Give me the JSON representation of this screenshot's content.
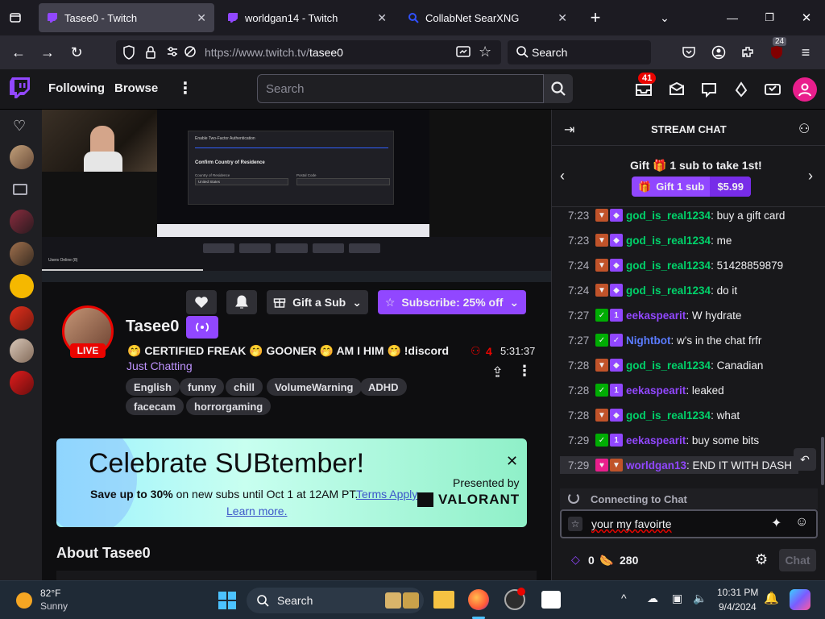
{
  "browser": {
    "tabs": [
      {
        "title": "Tasee0 - Twitch",
        "active": true
      },
      {
        "title": "worldgan14 - Twitch",
        "active": false
      },
      {
        "title": "CollabNet SearXNG",
        "active": false
      }
    ],
    "url_prefix": "https://www.twitch.tv/",
    "url_path": "tasee0",
    "search_placeholder": "Search",
    "extensions_badge": "24"
  },
  "twitch_nav": {
    "following": "Following",
    "browse": "Browse",
    "search_placeholder": "Search",
    "notifications_count": "41"
  },
  "stream": {
    "channel_name": "Tasee0",
    "live_label": "LIVE",
    "title": "🤭 CERTIFIED FREAK 🤭 GOONER 🤭 AM I HIM 🤭 !discord",
    "category": "Just Chatting",
    "viewers": "4",
    "uptime": "5:31:37",
    "tags": [
      "English",
      "funny",
      "chill",
      "VolumeWarning",
      "ADHD",
      "facecam",
      "horrorgaming"
    ],
    "gift_sub_label": "Gift a Sub",
    "subscribe_label": "Subscribe: 25% off"
  },
  "promo": {
    "headline": "Celebrate SUBtember!",
    "body_bold": "Save up to 30%",
    "body_rest": " on new subs until Oct 1 at 12AM PT.",
    "link1": "Terms Apply.",
    "link2": "Learn more.",
    "presented_by": "Presented by",
    "brand": "VALORANT"
  },
  "about_heading": "About Tasee0",
  "video_overlay": {
    "dialog_title": "Enable Two-Factor Authentication",
    "confirm_heading": "Confirm Country of Residence",
    "country_label": "Country of Residence",
    "country_value": "United States",
    "postal_label": "Postal Code",
    "taskbar_users": "Users Online (8)"
  },
  "chat": {
    "header": "STREAM CHAT",
    "gift_banner": "Gift 🎁 1 sub to take 1st!",
    "gift_button": "Gift 1 sub",
    "gift_price": "$5.99",
    "messages": [
      {
        "time": "7:23",
        "user": "god_is_real1234",
        "text": ": buy a gift card",
        "color": "green"
      },
      {
        "time": "7:23",
        "user": "god_is_real1234",
        "text": ": me",
        "color": "green"
      },
      {
        "time": "7:24",
        "user": "god_is_real1234",
        "text": ": 51428859879",
        "color": "green"
      },
      {
        "time": "7:24",
        "user": "god_is_real1234",
        "text": ": do it",
        "color": "green"
      },
      {
        "time": "7:27",
        "user": "eekaspearit",
        "text": ": W hydrate",
        "color": "purple"
      },
      {
        "time": "7:27",
        "user": "Nightbot",
        "text": ": w's in the chat frfr",
        "color": "blue"
      },
      {
        "time": "7:28",
        "user": "god_is_real1234",
        "text": ": Canadian",
        "color": "green"
      },
      {
        "time": "7:28",
        "user": "eekaspearit",
        "text": ": leaked",
        "color": "purple"
      },
      {
        "time": "7:28",
        "user": "god_is_real1234",
        "text": ": what",
        "color": "green"
      },
      {
        "time": "7:29",
        "user": "eekaspearit",
        "text": ": buy some bits",
        "color": "purple"
      },
      {
        "time": "7:29",
        "user": "worldgan13",
        "text": ": END IT WITH DASH",
        "color": "purple"
      }
    ],
    "connecting": "Connecting to Chat",
    "input_value": "your my favoirte",
    "bits": "0",
    "points": "280",
    "chat_button": "Chat"
  },
  "taskbar": {
    "temp": "82°F",
    "weather": "Sunny",
    "search": "Search",
    "time": "10:31 PM",
    "date": "9/4/2024"
  },
  "colors": {
    "twitch_purple": "#9147ff",
    "live_red": "#eb0400",
    "chat_green": "#00d26a"
  }
}
